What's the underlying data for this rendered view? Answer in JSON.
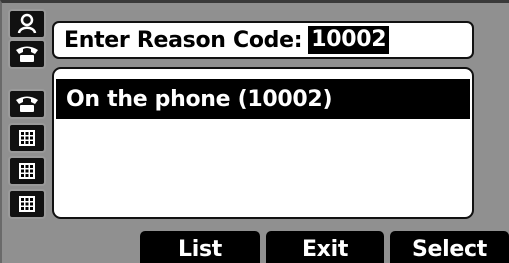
{
  "header": {
    "label": "Enter Reason Code:",
    "value": "10002"
  },
  "list": {
    "items": [
      {
        "label": "On the phone (10002)",
        "selected": true
      }
    ]
  },
  "line_keys": [
    {
      "icon": "person-icon"
    },
    {
      "icon": "handset-icon"
    },
    {
      "icon": "handset-icon"
    },
    {
      "icon": "keypad-icon"
    },
    {
      "icon": "keypad-icon"
    },
    {
      "icon": "keypad-icon"
    }
  ],
  "softkeys": {
    "list_label": "List",
    "exit_label": "Exit",
    "select_label": "Select"
  },
  "colors": {
    "screen_bg": "#909090",
    "highlight": "#000000",
    "panel_bg": "#ffffff"
  }
}
